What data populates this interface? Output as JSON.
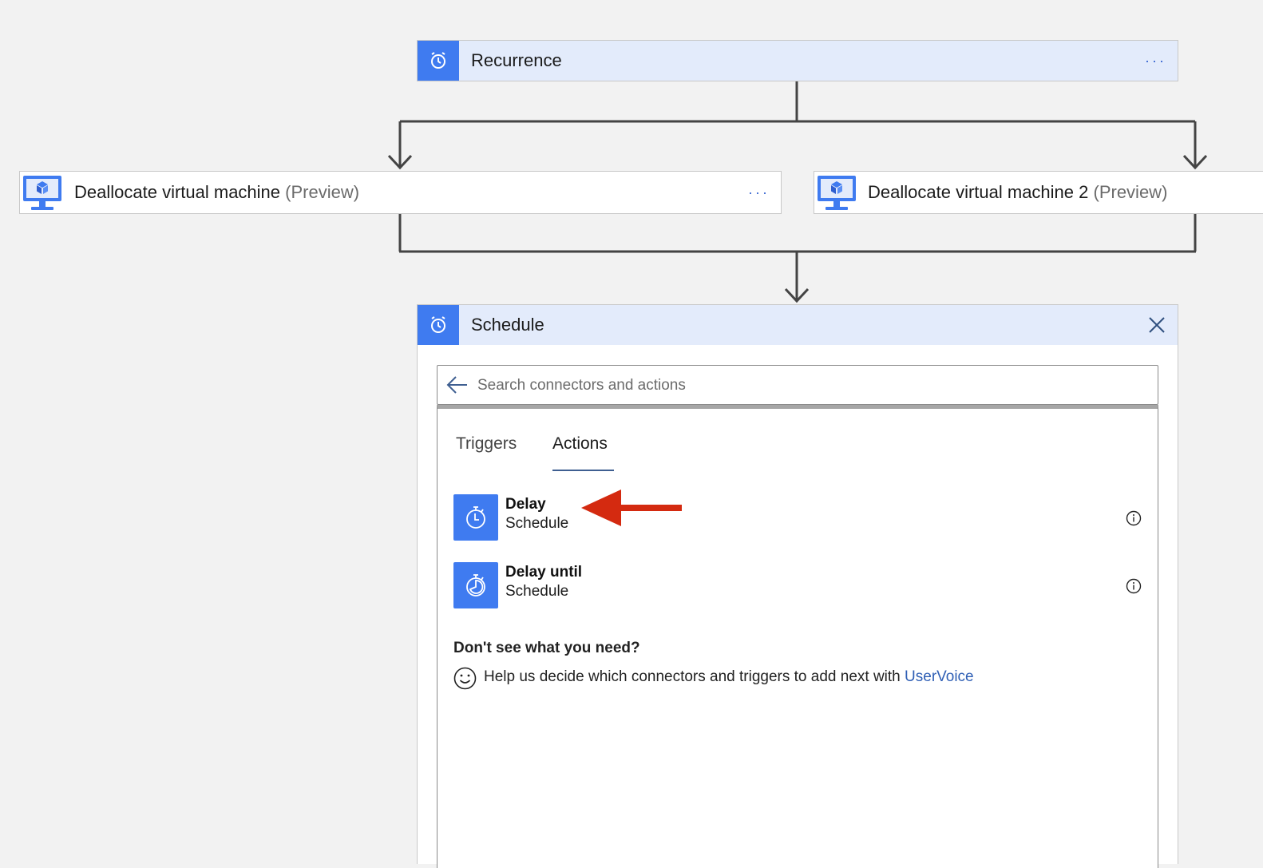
{
  "recurrence": {
    "title": "Recurrence",
    "icon": "alarm-clock-icon",
    "more_label": "···"
  },
  "vm1": {
    "title": "Deallocate virtual machine",
    "preview": "(Preview)",
    "icon": "virtual-machine-icon",
    "more_label": "···"
  },
  "vm2": {
    "title": "Deallocate virtual machine 2",
    "preview": "(Preview)",
    "icon": "virtual-machine-icon"
  },
  "schedule": {
    "title": "Schedule",
    "icon": "alarm-clock-icon",
    "search": {
      "placeholder": "Search connectors and actions",
      "value": ""
    },
    "tabs": [
      {
        "label": "Triggers",
        "selected": false
      },
      {
        "label": "Actions",
        "selected": true
      }
    ],
    "actions": [
      {
        "name": "Delay",
        "connector": "Schedule",
        "icon": "stopwatch-icon"
      },
      {
        "name": "Delay until",
        "connector": "Schedule",
        "icon": "stopwatch-until-icon"
      }
    ],
    "help": {
      "title": "Don't see what you need?",
      "text": "Help us decide which connectors and triggers to add next with",
      "link": "UserVoice"
    }
  },
  "colors": {
    "accent": "#3f7bf0",
    "header_bg": "#e3ebfb",
    "annotation_arrow": "#d42a10",
    "link": "#2f5fb5"
  }
}
